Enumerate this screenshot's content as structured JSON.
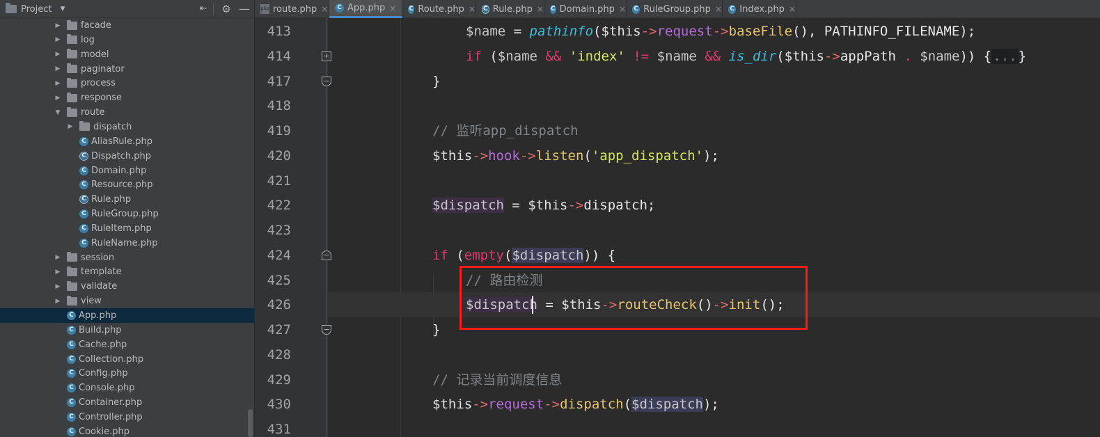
{
  "sidebar": {
    "title": "Project",
    "items": [
      {
        "kind": "folder",
        "label": "facade",
        "expanded": false
      },
      {
        "kind": "folder",
        "label": "log",
        "expanded": false
      },
      {
        "kind": "folder",
        "label": "model",
        "expanded": false
      },
      {
        "kind": "folder",
        "label": "paginator",
        "expanded": false
      },
      {
        "kind": "folder",
        "label": "process",
        "expanded": false
      },
      {
        "kind": "folder",
        "label": "response",
        "expanded": false
      },
      {
        "kind": "folder",
        "label": "route",
        "expanded": true
      },
      {
        "kind": "folder",
        "label": "dispatch",
        "expanded": false
      },
      {
        "kind": "class",
        "label": "AliasRule.php"
      },
      {
        "kind": "class",
        "label": "Dispatch.php"
      },
      {
        "kind": "class",
        "label": "Domain.php"
      },
      {
        "kind": "class",
        "label": "Resource.php"
      },
      {
        "kind": "class",
        "label": "Rule.php"
      },
      {
        "kind": "class",
        "label": "RuleGroup.php"
      },
      {
        "kind": "class",
        "label": "RuleItem.php"
      },
      {
        "kind": "class",
        "label": "RuleName.php"
      },
      {
        "kind": "folder",
        "label": "session",
        "expanded": false
      },
      {
        "kind": "folder",
        "label": "template",
        "expanded": false
      },
      {
        "kind": "folder",
        "label": "validate",
        "expanded": false
      },
      {
        "kind": "folder",
        "label": "view",
        "expanded": false
      },
      {
        "kind": "class",
        "label": "App.php",
        "selected": true
      },
      {
        "kind": "class",
        "label": "Build.php"
      },
      {
        "kind": "class",
        "label": "Cache.php"
      },
      {
        "kind": "class",
        "label": "Collection.php"
      },
      {
        "kind": "class",
        "label": "Config.php"
      },
      {
        "kind": "class",
        "label": "Console.php"
      },
      {
        "kind": "class",
        "label": "Container.php"
      },
      {
        "kind": "class",
        "label": "Controller.php"
      },
      {
        "kind": "class",
        "label": "Cookie.php"
      }
    ]
  },
  "tabs": [
    {
      "label": "route.php",
      "icon": "php-file-icon"
    },
    {
      "label": "App.php",
      "icon": "class-icon",
      "active": true
    },
    {
      "label": "Route.php",
      "icon": "class-icon"
    },
    {
      "label": "Rule.php",
      "icon": "abstract-class-icon"
    },
    {
      "label": "Domain.php",
      "icon": "class-icon"
    },
    {
      "label": "RuleGroup.php",
      "icon": "class-icon"
    },
    {
      "label": "Index.php",
      "icon": "class-icon"
    }
  ],
  "editor": {
    "line_numbers": [
      "413",
      "414",
      "417",
      "418",
      "419",
      "420",
      "421",
      "422",
      "423",
      "424",
      "425",
      "426",
      "427",
      "428",
      "429",
      "430",
      "431"
    ],
    "lines": {
      "l413": [
        "$name",
        " = ",
        "pathinfo",
        "(",
        "$this",
        "->",
        "request",
        "->",
        "baseFile",
        "(), PATHINFO_FILENAME);"
      ],
      "l414": [
        "if",
        " (",
        "$name",
        " ",
        "&&",
        " ",
        "'index'",
        " ",
        "!=",
        " ",
        "$name",
        " ",
        "&&",
        " ",
        "is_dir",
        "(",
        "$this",
        "->",
        "appPath",
        " ",
        ".",
        " ",
        "$name",
        ")) {",
        "...",
        "}"
      ],
      "l417": [
        "}"
      ],
      "l419": [
        "// 监听app_dispatch"
      ],
      "l420": [
        "$this",
        "->",
        "hook",
        "->",
        "listen",
        "(",
        "'app_dispatch'",
        ");"
      ],
      "l422": [
        "$dispatch",
        " = ",
        "$this",
        "->",
        "dispatch",
        ";"
      ],
      "l424": [
        "if",
        " (",
        "empty",
        "(",
        "$dispatch",
        ")) {"
      ],
      "l425": [
        "// 路由检测"
      ],
      "l426": [
        "$dispatch",
        " = ",
        "$this",
        "->",
        "routeCheck",
        "()",
        "->",
        "init",
        "();"
      ],
      "l427": [
        "}"
      ],
      "l429": [
        "// 记录当前调度信息"
      ],
      "l430": [
        "$this",
        "->",
        "request",
        "->",
        "dispatch",
        "(",
        "$dispatch",
        ");"
      ]
    }
  }
}
